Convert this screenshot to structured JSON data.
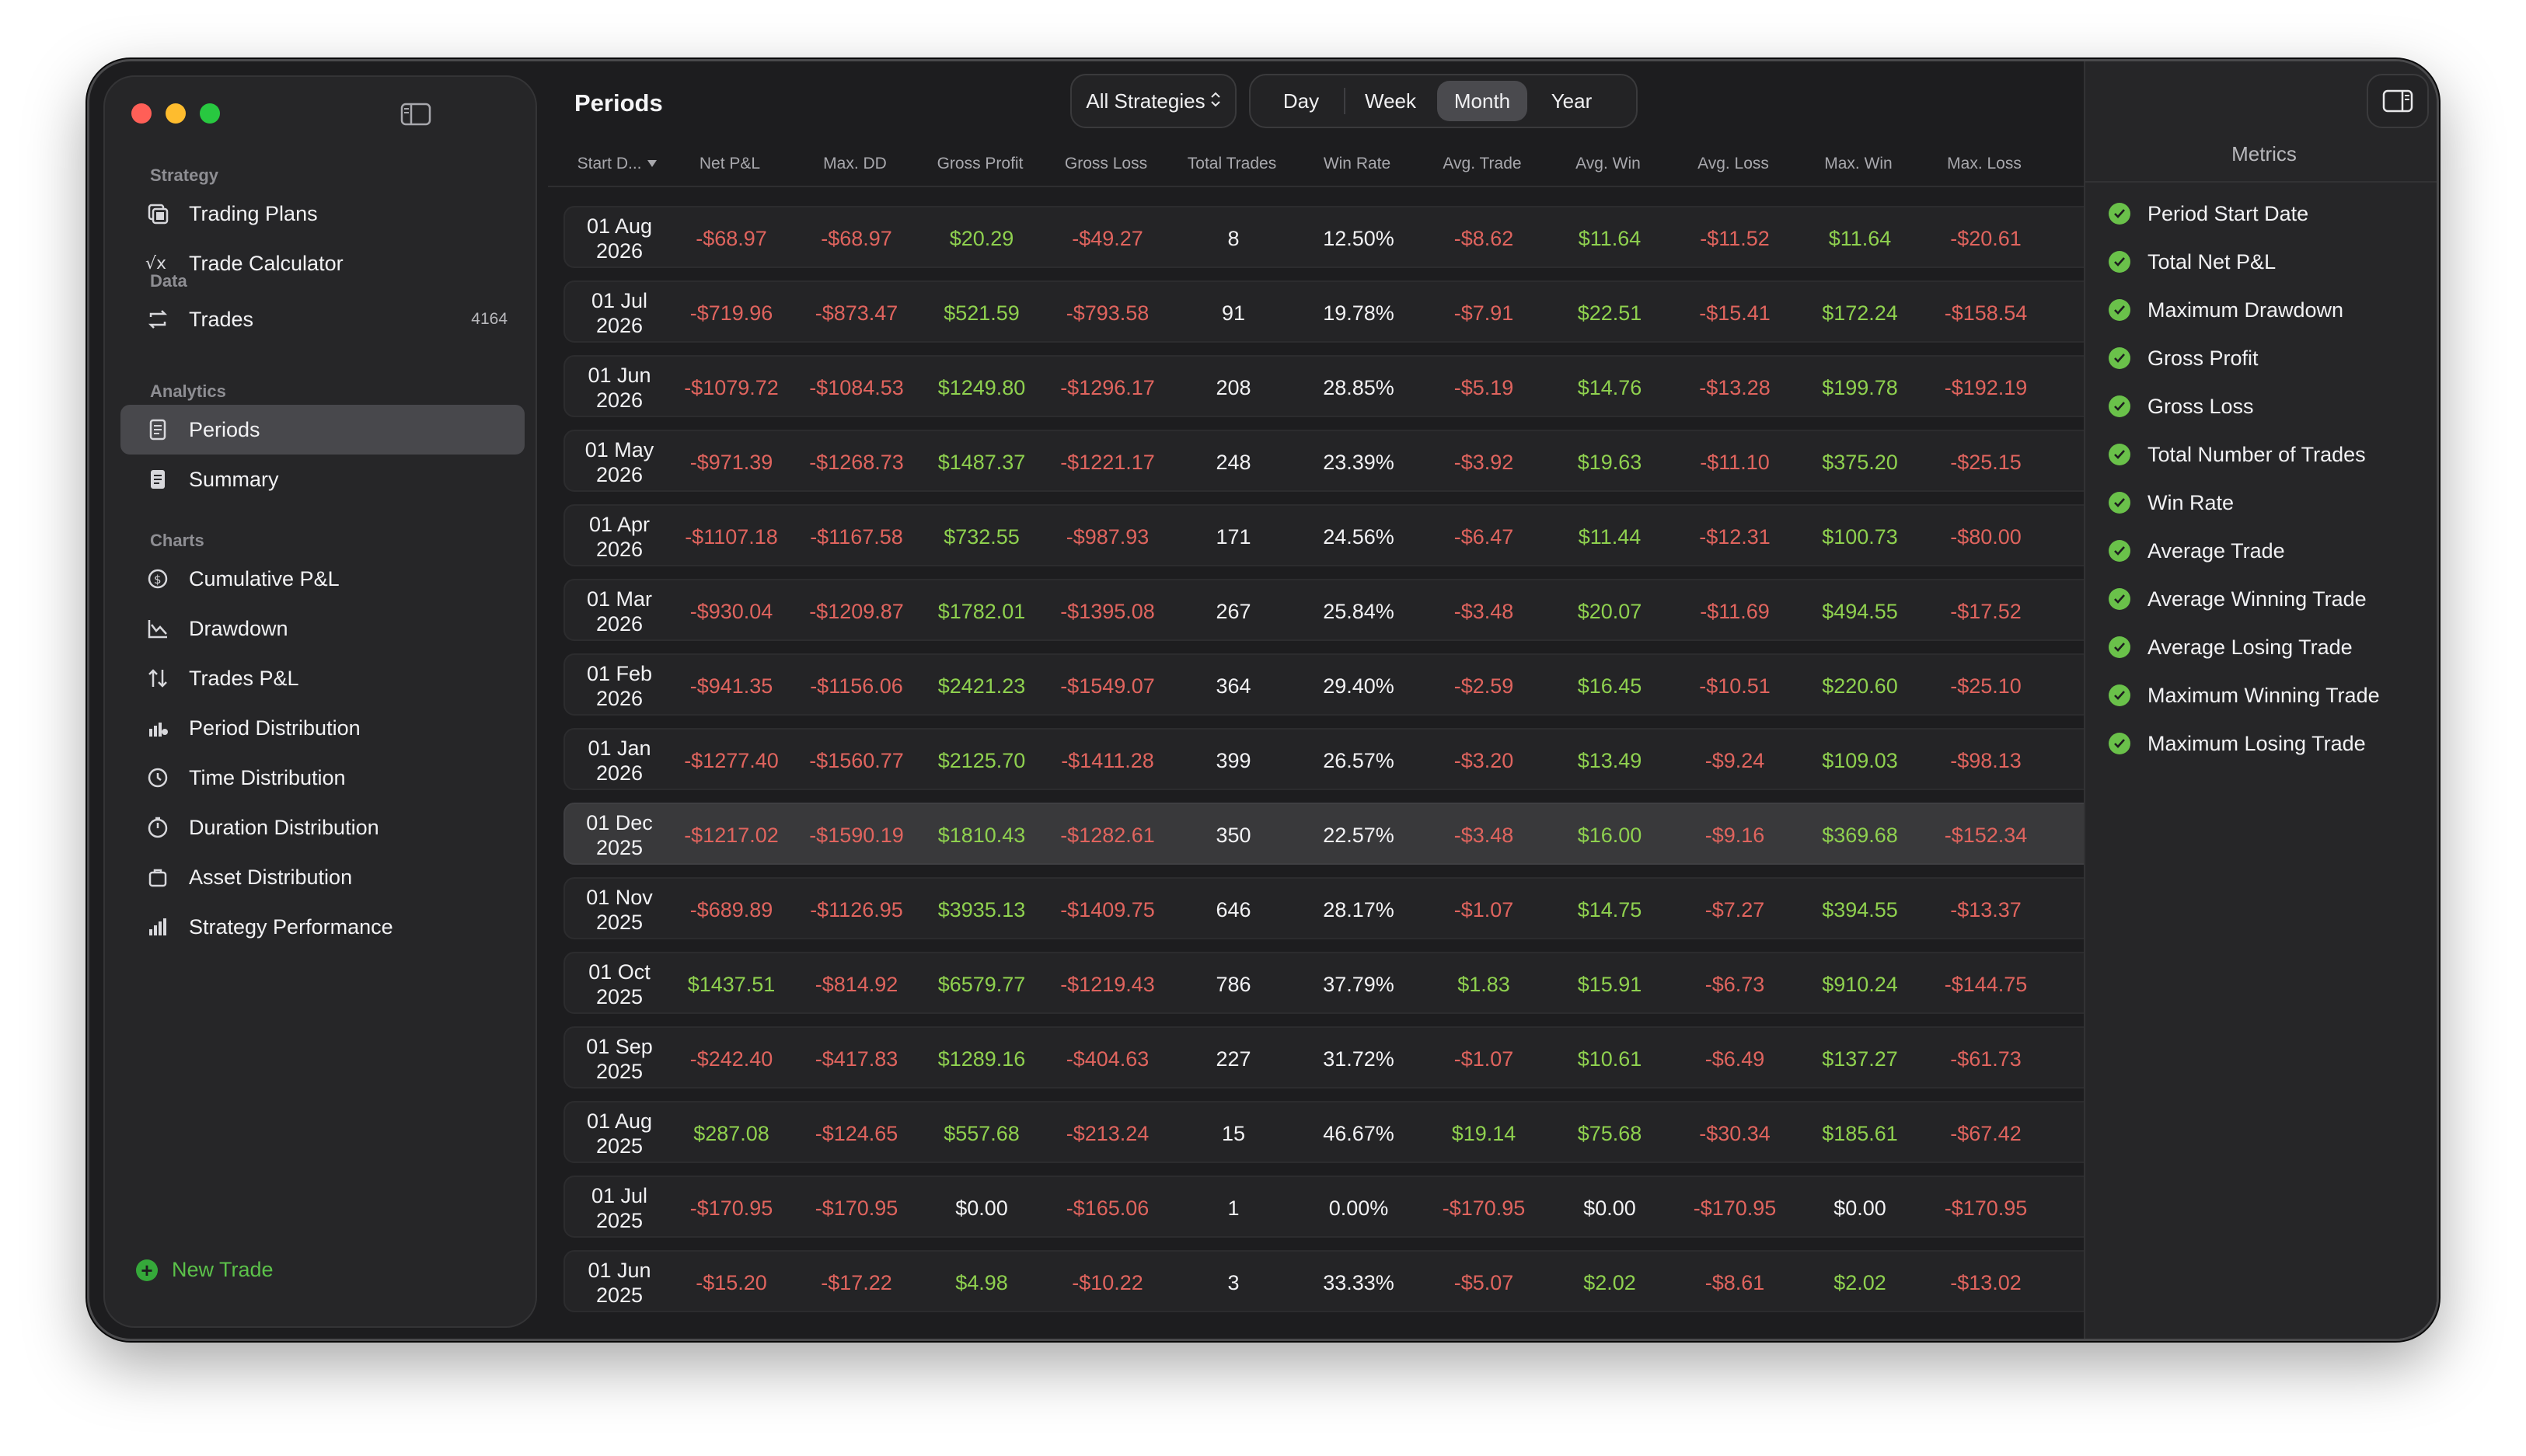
{
  "sidebar": {
    "sections": [
      {
        "header": "Strategy",
        "items": [
          {
            "label": "Trading Plans",
            "icon": "trading-plans-icon"
          },
          {
            "label": "Trade Calculator",
            "icon": "calculator-icon"
          }
        ]
      },
      {
        "header": "Data",
        "items": [
          {
            "label": "Trades",
            "icon": "trades-icon",
            "badge": "4164"
          }
        ]
      },
      {
        "header": "Analytics",
        "items": [
          {
            "label": "Periods",
            "icon": "periods-icon",
            "active": true
          },
          {
            "label": "Summary",
            "icon": "summary-icon"
          }
        ]
      },
      {
        "header": "Charts",
        "items": [
          {
            "label": "Cumulative P&L",
            "icon": "cumulative-pl-icon"
          },
          {
            "label": "Drawdown",
            "icon": "drawdown-icon"
          },
          {
            "label": "Trades P&L",
            "icon": "trades-pl-icon"
          },
          {
            "label": "Period Distribution",
            "icon": "period-distribution-icon"
          },
          {
            "label": "Time Distribution",
            "icon": "time-distribution-icon"
          },
          {
            "label": "Duration Distribution",
            "icon": "duration-distribution-icon"
          },
          {
            "label": "Asset Distribution",
            "icon": "asset-distribution-icon"
          },
          {
            "label": "Strategy Performance",
            "icon": "strategy-performance-icon"
          }
        ]
      }
    ],
    "new_trade_label": "New Trade"
  },
  "header": {
    "title": "Periods",
    "strategy_select": "All Strategies",
    "period_options": [
      "Day",
      "Week",
      "Month",
      "Year"
    ],
    "selected_period": "Month"
  },
  "table": {
    "columns": [
      "Start D...",
      "Net P&L",
      "Max. DD",
      "Gross Profit",
      "Gross Loss",
      "Total Trades",
      "Win Rate",
      "Avg. Trade",
      "Avg. Win",
      "Avg. Loss",
      "Max. Win",
      "Max. Loss"
    ],
    "highlighted_row": 8,
    "rows": [
      [
        [
          "01 Aug",
          "2026"
        ],
        "-$68.97",
        "-$68.97",
        "$20.29",
        "-$49.27",
        "8",
        "12.50%",
        "-$8.62",
        "$11.64",
        "-$11.52",
        "$11.64",
        "-$20.61"
      ],
      [
        [
          "01 Jul",
          "2026"
        ],
        "-$719.96",
        "-$873.47",
        "$521.59",
        "-$793.58",
        "91",
        "19.78%",
        "-$7.91",
        "$22.51",
        "-$15.41",
        "$172.24",
        "-$158.54"
      ],
      [
        [
          "01 Jun",
          "2026"
        ],
        "-$1079.72",
        "-$1084.53",
        "$1249.80",
        "-$1296.17",
        "208",
        "28.85%",
        "-$5.19",
        "$14.76",
        "-$13.28",
        "$199.78",
        "-$192.19"
      ],
      [
        [
          "01 May",
          "2026"
        ],
        "-$971.39",
        "-$1268.73",
        "$1487.37",
        "-$1221.17",
        "248",
        "23.39%",
        "-$3.92",
        "$19.63",
        "-$11.10",
        "$375.20",
        "-$25.15"
      ],
      [
        [
          "01 Apr",
          "2026"
        ],
        "-$1107.18",
        "-$1167.58",
        "$732.55",
        "-$987.93",
        "171",
        "24.56%",
        "-$6.47",
        "$11.44",
        "-$12.31",
        "$100.73",
        "-$80.00"
      ],
      [
        [
          "01 Mar",
          "2026"
        ],
        "-$930.04",
        "-$1209.87",
        "$1782.01",
        "-$1395.08",
        "267",
        "25.84%",
        "-$3.48",
        "$20.07",
        "-$11.69",
        "$494.55",
        "-$17.52"
      ],
      [
        [
          "01 Feb",
          "2026"
        ],
        "-$941.35",
        "-$1156.06",
        "$2421.23",
        "-$1549.07",
        "364",
        "29.40%",
        "-$2.59",
        "$16.45",
        "-$10.51",
        "$220.60",
        "-$25.10"
      ],
      [
        [
          "01 Jan",
          "2026"
        ],
        "-$1277.40",
        "-$1560.77",
        "$2125.70",
        "-$1411.28",
        "399",
        "26.57%",
        "-$3.20",
        "$13.49",
        "-$9.24",
        "$109.03",
        "-$98.13"
      ],
      [
        [
          "01 Dec",
          "2025"
        ],
        "-$1217.02",
        "-$1590.19",
        "$1810.43",
        "-$1282.61",
        "350",
        "22.57%",
        "-$3.48",
        "$16.00",
        "-$9.16",
        "$369.68",
        "-$152.34"
      ],
      [
        [
          "01 Nov",
          "2025"
        ],
        "-$689.89",
        "-$1126.95",
        "$3935.13",
        "-$1409.75",
        "646",
        "28.17%",
        "-$1.07",
        "$14.75",
        "-$7.27",
        "$394.55",
        "-$13.37"
      ],
      [
        [
          "01 Oct",
          "2025"
        ],
        "$1437.51",
        "-$814.92",
        "$6579.77",
        "-$1219.43",
        "786",
        "37.79%",
        "$1.83",
        "$15.91",
        "-$6.73",
        "$910.24",
        "-$144.75"
      ],
      [
        [
          "01 Sep",
          "2025"
        ],
        "-$242.40",
        "-$417.83",
        "$1289.16",
        "-$404.63",
        "227",
        "31.72%",
        "-$1.07",
        "$10.61",
        "-$6.49",
        "$137.27",
        "-$61.73"
      ],
      [
        [
          "01 Aug",
          "2025"
        ],
        "$287.08",
        "-$124.65",
        "$557.68",
        "-$213.24",
        "15",
        "46.67%",
        "$19.14",
        "$75.68",
        "-$30.34",
        "$185.61",
        "-$67.42"
      ],
      [
        [
          "01 Jul",
          "2025"
        ],
        "-$170.95",
        "-$170.95",
        "$0.00",
        "-$165.06",
        "1",
        "0.00%",
        "-$170.95",
        "$0.00",
        "-$170.95",
        "$0.00",
        "-$170.95"
      ],
      [
        [
          "01 Jun",
          "2025"
        ],
        "-$15.20",
        "-$17.22",
        "$4.98",
        "-$10.22",
        "3",
        "33.33%",
        "-$5.07",
        "$2.02",
        "-$8.61",
        "$2.02",
        "-$13.02"
      ]
    ]
  },
  "metrics_panel": {
    "title": "Metrics",
    "items": [
      "Period Start Date",
      "Total Net P&L",
      "Maximum Drawdown",
      "Gross Profit",
      "Gross Loss",
      "Total Number of Trades",
      "Win Rate",
      "Average Trade",
      "Average Winning Trade",
      "Average Losing Trade",
      "Maximum Winning Trade",
      "Maximum Losing Trade"
    ]
  },
  "colors": {
    "positive": "#8fd14f",
    "negative": "#e0645e",
    "accent_check": "#6ac14a"
  }
}
